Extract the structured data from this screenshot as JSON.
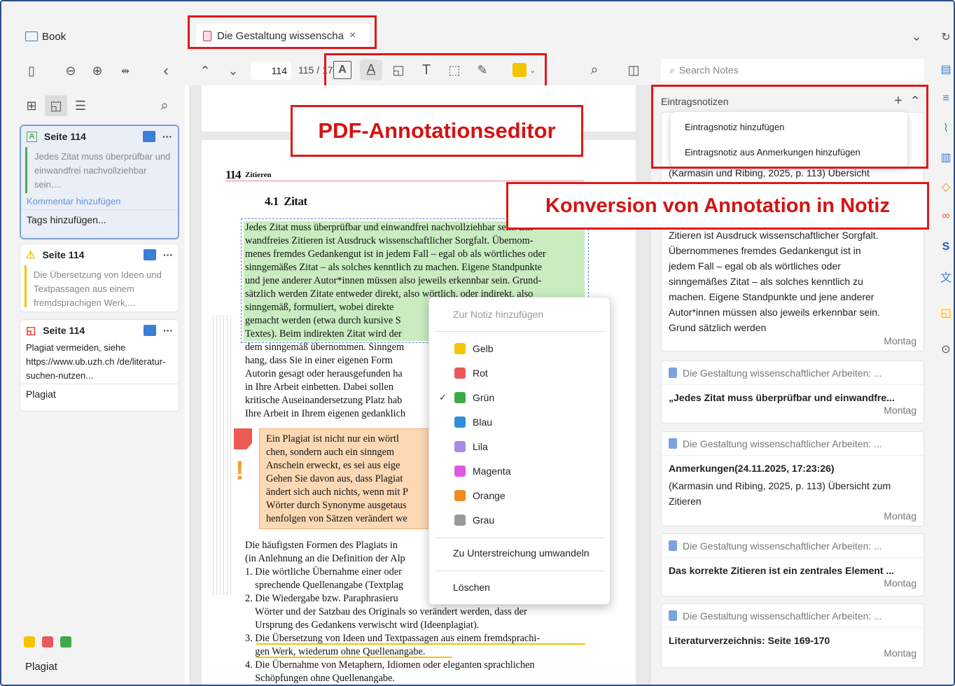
{
  "tabs": {
    "library_label": "Book",
    "document_tab": "Die Gestaltung wissenscha"
  },
  "toolbar": {
    "current_page": "114",
    "page_total": "115 / 17",
    "highlight_color": "#f5c400"
  },
  "left_sidebar": {
    "annotations": [
      {
        "page": "Seite 114",
        "type": "highlight",
        "color": "#4caf50",
        "text": "Jedes Zitat muss überprüfbar und einwandfrei nachvollziehbar sein....",
        "comment": "Kommentar hinzufügen",
        "tags": "Tags hinzufügen..."
      },
      {
        "page": "Seite 114",
        "type": "highlight",
        "color": "#f5c400",
        "text": "Die Übersetzung von Ideen und Textpassagen aus einem fremdsprachigen Werk,...",
        "comment": "",
        "tags": ""
      },
      {
        "page": "Seite 114",
        "type": "note",
        "color": "#e53935",
        "text": "Plagiat vermeiden, siehe https://www.ub.uzh.ch /de/literatur-suchen-nutzen...",
        "comment": "",
        "tags": "Plagiat"
      }
    ],
    "filter_colors": [
      "#f5c400",
      "#e85a5a",
      "#3daa47"
    ],
    "bottom_tag": "Plagiat"
  },
  "callouts": {
    "editor": "PDF-Annotationseditor",
    "conversion": "Konversion von Annotation in Notiz"
  },
  "pdf": {
    "page_number": "114",
    "running_head": "Zitieren",
    "section": "4.1  Zitat",
    "lines": [
      "Jedes Zitat muss überprüfbar und einwandfrei nachvollziehbar sein. Ein",
      "wandfreies Zitieren ist Ausdruck wissenschaftlicher Sorgfalt. Übernom-",
      "menes fremdes Gedankengut ist in jedem Fall – egal ob als wörtliches oder",
      "sinngemäßes Zitat – als solches kenntlich zu machen. Eigene Standpunkte",
      "und jene anderer Autor*innen müssen also jeweils erkennbar sein. Grund-",
      "sätzlich werden Zitate entweder direkt, also wörtlich, oder indirekt, also",
      "sinngemäß, formuliert, wobei direkte",
      "gemacht werden (etwa durch kursive S",
      "Textes). Beim indirekten Zitat wird der",
      "dem sinngemäß übernommen. Sinngem",
      "hang, dass Sie in einer eigenen Form",
      "Autorin gesagt oder herausgefunden ha",
      "in Ihre Arbeit einbetten. Dabei sollen",
      "kritische Auseinandersetzung Platz hab",
      "Ihre Arbeit in Ihrem eigenen gedanklich"
    ],
    "box_lines": [
      "Ein Plagiat ist nicht nur ein wörtl",
      "chen, sondern auch ein sinngem",
      "Anschein erweckt, es sei aus eige",
      "Gehen Sie davon aus, dass Plagiat",
      "ändert sich auch nichts, wenn mit P",
      "Wörter durch Synonyme ausgetaus",
      "henfolgen von Sätzen verändert we"
    ],
    "lower_lines": [
      "Die häufigsten Formen des Plagiats in",
      "(in Anlehnung an die Definition der Alp",
      "1. Die wörtliche Übernahme einer oder",
      "    sprechende Quellenangabe (Textplag",
      "2. Die Wiedergabe bzw. Paraphrasieru",
      "    Wörter und der Satzbau des Originals so verändert werden, dass der",
      "    Ursprung des Gedankens verwischt wird (Ideenplagiat).",
      "3. Die Übersetzung von Ideen und Textpassagen aus einem fremdsprachi-",
      "    gen Werk, wiederum ohne Quellenangabe.",
      "4. Die Übernahme von Metaphern, Idiomen oder eleganten sprachlichen",
      "    Schöpfungen ohne Quellenangabe."
    ]
  },
  "context_menu": {
    "header": "Zur Notiz hinzufügen",
    "colors": [
      {
        "label": "Gelb",
        "color": "#f5c400",
        "checked": false
      },
      {
        "label": "Rot",
        "color": "#e85a5a",
        "checked": false
      },
      {
        "label": "Grün",
        "color": "#3daa47",
        "checked": true
      },
      {
        "label": "Blau",
        "color": "#2f8fd8",
        "checked": false
      },
      {
        "label": "Lila",
        "color": "#a889e6",
        "checked": false
      },
      {
        "label": "Magenta",
        "color": "#e05ae0",
        "checked": false
      },
      {
        "label": "Orange",
        "color": "#f08a24",
        "checked": false
      },
      {
        "label": "Grau",
        "color": "#9a9a9a",
        "checked": false
      }
    ],
    "convert": "Zu Unterstreichung umwandeln",
    "delete": "Löschen"
  },
  "notes_pane": {
    "search_placeholder": "Search Notes",
    "section_title": "Eintragsnotizen",
    "dropdown": [
      "Eintragsnotiz hinzufügen",
      "Eintragsnotiz aus Anmerkungen hinzufügen"
    ],
    "first_note_citation": "(Karmasin und Ribing, 2025, p. 113) Übersicht",
    "first_note_body": [
      "Zitieren ist Ausdruck wissenschaftlicher Sorgfalt.",
      "Übernommenes fremdes Gedankengut ist in",
      "jedem Fall – egal ob als wörtliches oder",
      "sinngemäßes Zitat – als solches kenntlich zu",
      "machen. Eigene Standpunkte und jene anderer",
      "Autor*innen müssen also jeweils erkennbar sein.",
      "Grund sätzlich werden"
    ],
    "first_note_date": "Montag",
    "notes": [
      {
        "source": "Die Gestaltung wissenschaftlicher Arbeiten: ...",
        "title": "„Jedes Zitat muss überprüfbar und einwandfre...",
        "body": "",
        "date": "Montag"
      },
      {
        "source": "Die Gestaltung wissenschaftlicher Arbeiten: ...",
        "title": "Anmerkungen(24.11.2025, 17:23:26)",
        "body": "(Karmasin und Ribing, 2025, p. 113) Übersicht zum Zitieren",
        "date": "Montag"
      },
      {
        "source": "Die Gestaltung wissenschaftlicher Arbeiten: ...",
        "title": "Das korrekte Zitieren ist ein zentrales Element ...",
        "body": "",
        "date": "Montag"
      },
      {
        "source": "Die Gestaltung wissenschaftlicher Arbeiten: ...",
        "title": "Literaturverzeichnis: Seite 169-170",
        "body": "",
        "date": "Montag"
      }
    ]
  }
}
